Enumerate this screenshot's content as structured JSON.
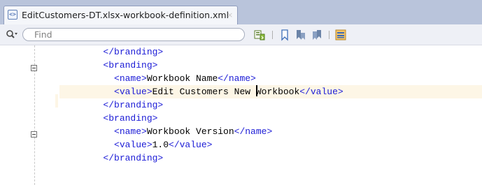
{
  "tab": {
    "title": "EditCustomers-DT.xlsx-workbook-definition.xml",
    "close_glyph": "×",
    "icon": "xml-file-icon"
  },
  "toolbar": {
    "search_placeholder": "Find",
    "search_icon": "magnifier-dropdown-icon",
    "buttons": [
      {
        "icon": "find-usages-icon"
      },
      {
        "icon": "bookmark-icon"
      },
      {
        "icon": "previous-bookmark-icon"
      },
      {
        "icon": "next-bookmark-icon"
      },
      {
        "icon": "toggle-view-icon"
      }
    ]
  },
  "code": {
    "lines": [
      {
        "indent": "    ",
        "parts": [
          [
            "tag",
            "</branding>"
          ]
        ]
      },
      {
        "indent": "    ",
        "parts": [
          [
            "tag",
            "<branding>"
          ]
        ]
      },
      {
        "indent": "      ",
        "parts": [
          [
            "tag",
            "<name>"
          ],
          [
            "text",
            "Workbook Name"
          ],
          [
            "tag",
            "</name>"
          ]
        ]
      },
      {
        "indent": "      ",
        "parts": [
          [
            "tag",
            "<value>"
          ],
          [
            "text",
            "Edit Customers New "
          ],
          [
            "caret",
            ""
          ],
          [
            "text",
            "Workbook"
          ],
          [
            "tag",
            "</value>"
          ]
        ]
      },
      {
        "indent": "    ",
        "parts": [
          [
            "tag",
            "</branding>"
          ]
        ]
      },
      {
        "indent": "    ",
        "parts": [
          [
            "tag",
            "<branding>"
          ]
        ]
      },
      {
        "indent": "      ",
        "parts": [
          [
            "tag",
            "<name>"
          ],
          [
            "text",
            "Workbook Version"
          ],
          [
            "tag",
            "</name>"
          ]
        ]
      },
      {
        "indent": "      ",
        "parts": [
          [
            "tag",
            "<value>"
          ],
          [
            "text",
            "1.0"
          ],
          [
            "tag",
            "</value>"
          ]
        ]
      },
      {
        "indent": "    ",
        "parts": [
          [
            "tag",
            "</branding>"
          ]
        ]
      }
    ],
    "current_line": 3
  },
  "colors": {
    "tag": "#1b1bd6",
    "text": "#000000",
    "current_line_bg": "#fdf6e6",
    "tab_bar": "#b9c4db"
  }
}
